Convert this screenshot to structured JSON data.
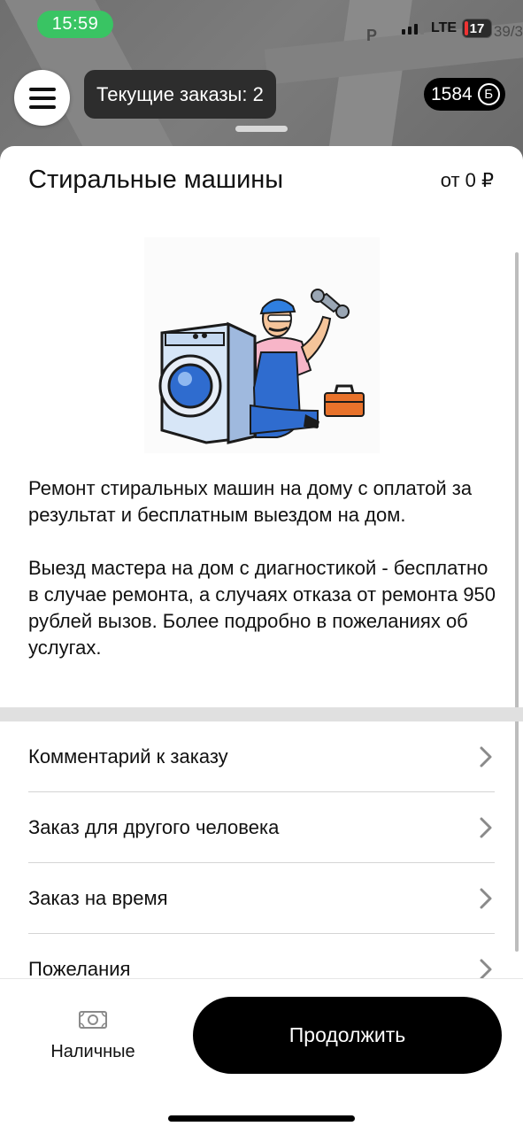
{
  "status_bar": {
    "time": "15:59",
    "network": "LTE",
    "battery": "17",
    "signal_bars": 3
  },
  "map": {
    "street_letter": "P",
    "house_number": "39/3"
  },
  "header": {
    "orders_label": "Текущие заказы: 2",
    "balance": "1584",
    "balance_icon": "Б"
  },
  "service": {
    "title": "Стиральные машины",
    "price": "от 0 ₽",
    "image_icon": "washing-machine-repairman-illustration",
    "description_1": "Ремонт стиральных машин на дому с оплатой за результат и бесплатным выездом на дом.",
    "description_2": "Выезд мастера на дом с диагностикой - бесплатно в случае ремонта, а случаях отказа от ремонта 950 рублей вызов. Более подробно в пожеланиях об услугах."
  },
  "options": [
    {
      "label": "Комментарий к заказу"
    },
    {
      "label": "Заказ для другого человека"
    },
    {
      "label": "Заказ на время"
    },
    {
      "label": "Пожелания"
    }
  ],
  "bottom": {
    "payment_label": "Наличные",
    "continue_label": "Продолжить"
  },
  "colors": {
    "status_green": "#39c463",
    "accent_black": "#000000",
    "battery_low": "#e33333"
  }
}
